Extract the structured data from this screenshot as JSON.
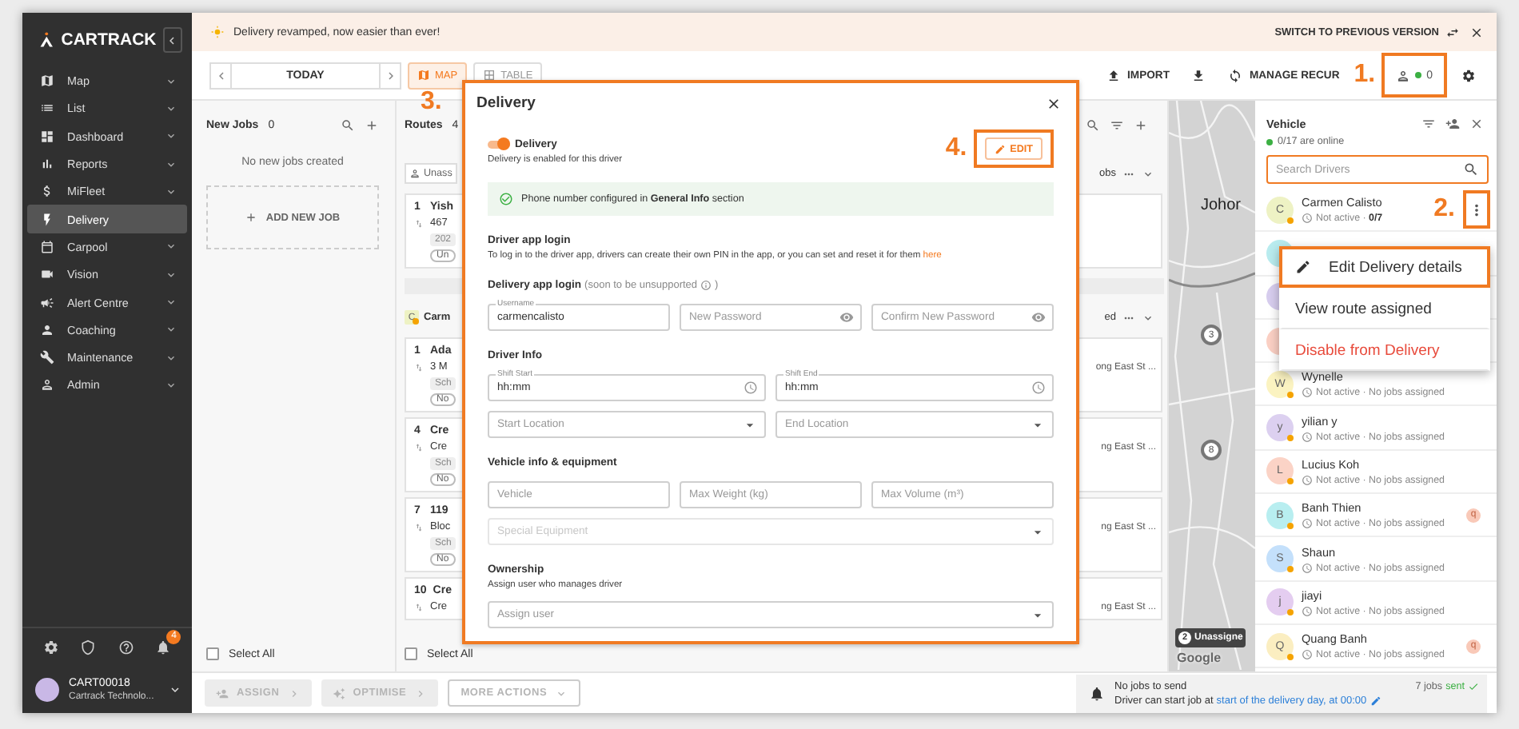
{
  "sidebar": {
    "brand": "CARTRACK",
    "items": [
      {
        "label": "Map",
        "selected": false,
        "expandable": true
      },
      {
        "label": "List",
        "selected": false,
        "expandable": true
      },
      {
        "label": "Dashboard",
        "selected": false,
        "expandable": true
      },
      {
        "label": "Reports",
        "selected": false,
        "expandable": true
      },
      {
        "label": "MiFleet",
        "selected": false,
        "expandable": true
      },
      {
        "label": "Delivery",
        "selected": true,
        "expandable": false
      },
      {
        "label": "Carpool",
        "selected": false,
        "expandable": true
      },
      {
        "label": "Vision",
        "selected": false,
        "expandable": true
      },
      {
        "label": "Alert Centre",
        "selected": false,
        "expandable": true
      },
      {
        "label": "Coaching",
        "selected": false,
        "expandable": true
      },
      {
        "label": "Maintenance",
        "selected": false,
        "expandable": true
      },
      {
        "label": "Admin",
        "selected": false,
        "expandable": true
      }
    ],
    "notifications": "4",
    "user": {
      "id": "CART00018",
      "company": "Cartrack Technolo..."
    }
  },
  "banner": {
    "message": "Delivery revamped, now easier than ever!",
    "switch_label": "SWITCH TO PREVIOUS VERSION"
  },
  "toolbar": {
    "date": "TODAY",
    "views": [
      {
        "label": "MAP",
        "selected": true,
        "annotation": "3."
      },
      {
        "label": "TABLE",
        "selected": false
      }
    ],
    "import_label": "IMPORT",
    "recurring_label": "MANAGE RECUR",
    "drivers_button": {
      "count": "0",
      "highlighted": true,
      "annotation": "1."
    }
  },
  "new_jobs": {
    "title": "New Jobs",
    "count": "0",
    "empty_text": "No new jobs created",
    "add_label": "ADD NEW JOB",
    "select_all": {
      "label": "Select All",
      "checked": false
    }
  },
  "routes": {
    "title": "Routes",
    "count": "4",
    "groups": [
      {
        "kind": "unassigned",
        "label": "Unass",
        "tail": "obs",
        "cards": [
          {
            "number": "1",
            "title": "Yish",
            "address": "467",
            "chip": "202",
            "tag": "Un"
          }
        ]
      },
      {
        "kind": "driver",
        "label": "Carm",
        "avatar": "C",
        "color": "#eef2c4",
        "tail": "ed",
        "cards": [
          {
            "number": "1",
            "title": "Ada",
            "address": "3 M",
            "chip": "Sch",
            "tag": "No",
            "tail": "ong East St ..."
          },
          {
            "number": "4",
            "title": "Cre",
            "address": "Cre",
            "chip": "Sch",
            "tag": "No",
            "tail": "ng East St ..."
          },
          {
            "number": "7",
            "title": "119",
            "address": "Bloc",
            "chip": "Sch",
            "tag": "No",
            "tail": "ng East St ..."
          },
          {
            "number": "10",
            "title": "Cre",
            "address": "Cre",
            "tail": "ng East St ..."
          }
        ]
      }
    ],
    "select_all": {
      "label": "Select All",
      "checked": false
    }
  },
  "map": {
    "place": "Johor",
    "markers": [
      "3",
      "8"
    ],
    "unassigned": {
      "count": "2",
      "label": "Unassigne"
    },
    "attribution": "Google"
  },
  "vehicle_panel": {
    "title": "Vehicle",
    "online": "0/17 are online",
    "search_placeholder": "Search Drivers",
    "search_focused": true,
    "drivers": [
      {
        "kind": "driver",
        "initial": "C",
        "name": "Carmen Calisto",
        "status": "Not active · **0/7**",
        "color": "#eef2c4",
        "menu": {
          "annotation": "2.",
          "highlighted": true
        }
      },
      {
        "kind": "covered",
        "color": "#b9ecef"
      },
      {
        "kind": "covered",
        "color": "#d7cdee"
      },
      {
        "kind": "covered",
        "color": "#fbd0c4"
      },
      {
        "kind": "driver",
        "initial": "W",
        "name": "Wynelle",
        "status": "Not active · No jobs assigned",
        "color": "#fbf3c1"
      },
      {
        "kind": "driver",
        "initial": "y",
        "name": "yilian y",
        "status": "Not active · No jobs assigned",
        "color": "#dcd0f0"
      },
      {
        "kind": "driver",
        "initial": "L",
        "name": "Lucius Koh",
        "status": "Not active · No jobs assigned",
        "color": "#fbd3c6"
      },
      {
        "kind": "driver",
        "initial": "B",
        "name": "Banh Thien",
        "status": "Not active · No jobs assigned",
        "color": "#b8eef0",
        "badge": "q"
      },
      {
        "kind": "driver",
        "initial": "S",
        "name": "Shaun",
        "status": "Not active · No jobs assigned",
        "color": "#c4e0fb"
      },
      {
        "kind": "driver",
        "initial": "j",
        "name": "jiayi",
        "status": "Not active · No jobs assigned",
        "color": "#e4cdf0"
      },
      {
        "kind": "driver",
        "initial": "Q",
        "name": "Quang Banh",
        "status": "Not active · No jobs assigned",
        "color": "#fbeec1",
        "badge": "q"
      }
    ],
    "menu": [
      {
        "label": "Edit Delivery details",
        "kind": "edit",
        "highlighted": true
      },
      {
        "label": "View route assigned",
        "kind": "plain",
        "highlighted": false
      },
      {
        "label": "Disable from Delivery",
        "kind": "danger",
        "highlighted": false
      }
    ]
  },
  "modal": {
    "title": "Delivery",
    "highlighted": true,
    "toggle": {
      "label": "Delivery",
      "on": true,
      "description": "Delivery is enabled for this driver"
    },
    "edit_button": {
      "label": "EDIT",
      "highlighted": true,
      "annotation": "4."
    },
    "info": "Phone number configured in **General Info** section",
    "sections": [
      {
        "title": "Driver app login",
        "description": "To log in to the driver app, drivers can create their own PIN in the app, or you can set and reset it for them",
        "link": "here"
      },
      {
        "title": "Delivery app login",
        "note": "(soon to be unsupported",
        "note_close": ")",
        "fields": [
          {
            "kind": "text",
            "label": "Username",
            "value": "carmencalisto",
            "disabled": false
          },
          {
            "kind": "password",
            "placeholder": "New Password",
            "disabled": false
          },
          {
            "kind": "password",
            "placeholder": "Confirm New Password",
            "disabled": false
          }
        ]
      },
      {
        "title": "Driver Info",
        "fields": [
          {
            "kind": "time",
            "label": "Shift Start",
            "value": "hh:mm",
            "disabled": false
          },
          {
            "kind": "time",
            "label": "Shift End",
            "value": "hh:mm",
            "disabled": false
          },
          {
            "kind": "select",
            "placeholder": "Start Location",
            "disabled": false
          },
          {
            "kind": "select",
            "placeholder": "End Location",
            "disabled": false
          }
        ]
      },
      {
        "title": "Vehicle info & equipment",
        "fields": [
          {
            "kind": "text",
            "placeholder": "Vehicle",
            "disabled": false
          },
          {
            "kind": "text",
            "placeholder": "Max Weight (kg)",
            "disabled": false
          },
          {
            "kind": "text",
            "placeholder": "Max Volume (m³)",
            "disabled": false
          },
          {
            "kind": "select",
            "placeholder": "Special Equipment",
            "disabled": true
          }
        ]
      },
      {
        "title": "Ownership",
        "description": "Assign user who manages driver",
        "fields": [
          {
            "kind": "select",
            "placeholder": "Assign user",
            "disabled": false
          }
        ]
      }
    ]
  },
  "footer": {
    "buttons": [
      {
        "kind": "assign",
        "label": "ASSIGN",
        "disabled": true
      },
      {
        "kind": "optimise",
        "label": "OPTIMISE",
        "disabled": true
      },
      {
        "kind": "more",
        "label": "MORE ACTIONS",
        "disabled": true
      }
    ],
    "notice": {
      "title": "No jobs to send",
      "text": "Driver can start job at",
      "link": "start of the delivery day, at 00:00",
      "count": "7 jobs",
      "count_status": "sent"
    }
  }
}
